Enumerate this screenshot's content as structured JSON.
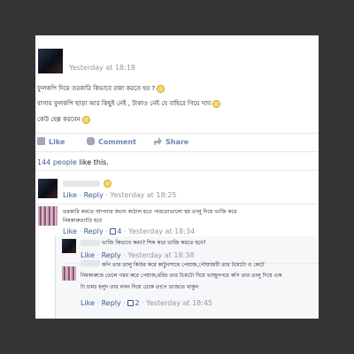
{
  "post": {
    "timestamp": "Yesterday at 18:18",
    "lines": [
      "ফুলকপি দিয়ে তরকারি কিভাবে রান্না করতে হয় ?",
      "বাসায় ফুলকপি ছাড়া আর কিছুই নেই , টাকাও নেই যে বাহিরে গিয়ে খাব",
      "কেউ হেল্প করবেন"
    ]
  },
  "actions": {
    "like": "Like",
    "comment": "Comment",
    "share": "Share"
  },
  "likes": {
    "count_text": "144 people",
    "suffix": "like this."
  },
  "comments": [
    {
      "like": "Like",
      "reply": "Reply",
      "timestamp": "Yesterday at 18:25"
    },
    {
      "text_lines": [
        "তরকারি করতে আপনার জন্যে কাঠাল হতে পারতোভালো হয় তালু দিয়ে ভাজি করে",
        "নিমকারুত্যাড়ি হবে"
      ],
      "like": "Like",
      "reply": "Reply",
      "like_count": "4",
      "timestamp": "Yesterday at 18:34"
    }
  ],
  "replies": [
    {
      "text": "ভাজি কিভাবে করব? শিক করে ভাজি করতে হবে?",
      "like": "Like",
      "reply": "Reply",
      "timestamp": "Yesterday at 18:38"
    },
    {
      "text_lines": [
        "কপি তার তালু কিউর করে কাটুনসাথে পেয়াজ,পৌয়াজটি তার টমেটো ও কেটে",
        "নিমকারুত্তে তেলে গরম করে পেয়াজ,মরিচ তার টমেটো দিয়ে ভাজুনপরে কপি তার তালু দিয়ে এক",
        "টা চামচ হলুদ তার লবন দিয়ে ঢেকে তাপে ভাজতে থাকুন"
      ],
      "like": "Like",
      "reply": "Reply",
      "like_count": "2",
      "timestamp": "Yesterday at 18:45"
    }
  ]
}
